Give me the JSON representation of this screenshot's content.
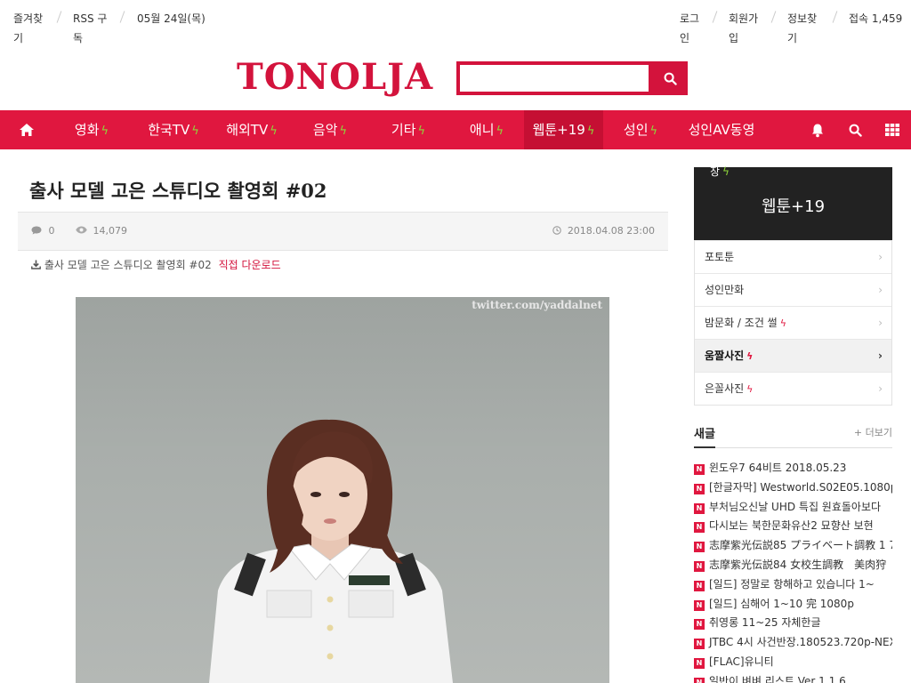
{
  "topbar": {
    "favorites": "즐겨찾기",
    "rss": "RSS 구독",
    "date": "05월 24일(목)",
    "login": "로그인",
    "join": "회원가입",
    "find": "정보찾기",
    "visitors": "접속 1,459"
  },
  "logo": "TONOLJA",
  "search": {
    "placeholder": ""
  },
  "nav": {
    "items": [
      {
        "label": "영화"
      },
      {
        "label": "한국TV"
      },
      {
        "label": "해외TV"
      },
      {
        "label": "음악"
      },
      {
        "label": "기타"
      },
      {
        "label": "애니"
      },
      {
        "label": "웹툰+19"
      },
      {
        "label": "성인"
      },
      {
        "label": "성인AV동영"
      }
    ]
  },
  "article": {
    "title": "출사 모델 고은 스튜디오 촬영회 #02",
    "comments": "0",
    "views": "14,079",
    "datetime": "2018.04.08 23:00",
    "download_name": "출사 모델 고은 스튜디오 촬영회 #02",
    "download_link": "직접 다운로드",
    "watermark": "twitter.com/yaddalnet"
  },
  "sidebar": {
    "head_small": "창",
    "head_title": "웹툰+19",
    "menu": [
      {
        "label": "포토툰"
      },
      {
        "label": "성인만화"
      },
      {
        "label": "밤문화 / 조건 썰"
      },
      {
        "label": "움짤사진"
      },
      {
        "label": "은꼴사진"
      }
    ],
    "new_title": "새글",
    "more": "+ 더보기",
    "new_posts": [
      "윈도우7 64비트 2018.05.23",
      "[한글자막] Westworld.S02E05.1080p.",
      "부처님오신날 UHD 특집 원효돌아보다",
      "다시보는 북한문화유산2 묘향산 보현",
      "志摩紫光伝説85 プライベート調教 1 7",
      "志摩紫光伝説84 女校生調教　美肉狩",
      "[일드] 정말로 항해하고 있습니다 1~",
      "[일드] 심해어 1~10 完 1080p",
      "취영롱 11~25 자체한글",
      "JTBC 4시 사건반장.180523.720p-NEX",
      "[FLAC]유니티",
      "일반이 벼벼 리스트 Ver 1.1.6"
    ]
  }
}
